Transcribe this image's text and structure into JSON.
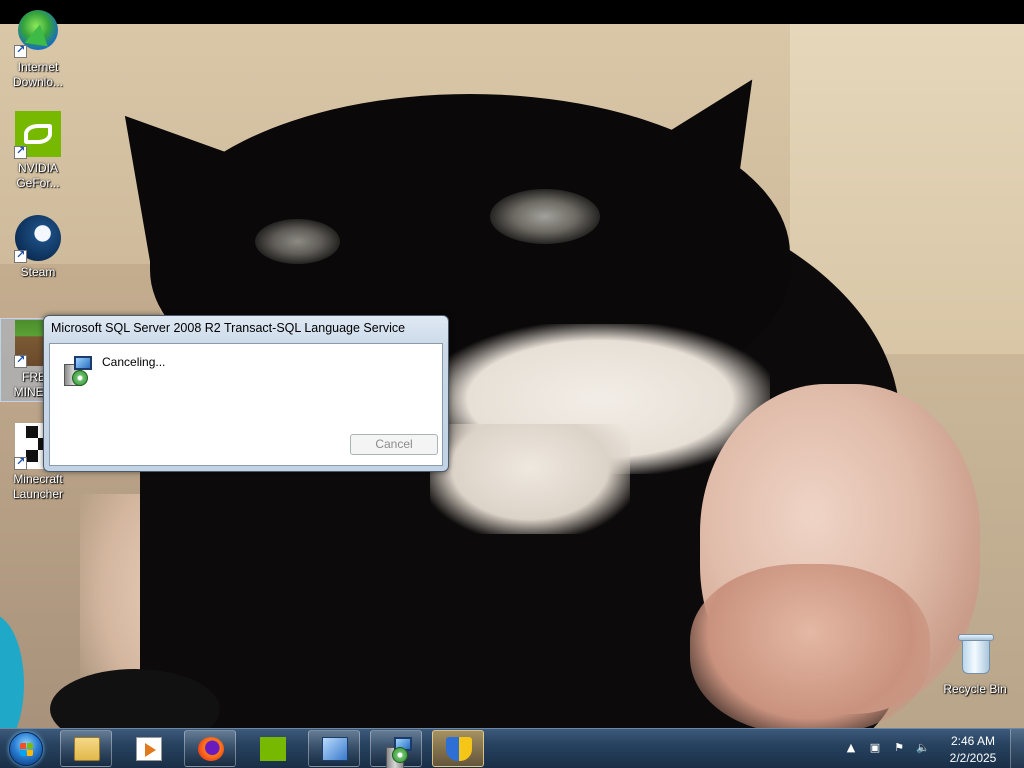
{
  "desktop": {
    "icons": [
      {
        "label": "Internet Downlo...",
        "icon": "internet-download-manager-icon"
      },
      {
        "label": "NVIDIA GeFor...",
        "icon": "nvidia-geforce-icon"
      },
      {
        "label": "Steam",
        "icon": "steam-icon"
      },
      {
        "label": "FREE MINEC...",
        "icon": "minecraft-icon"
      },
      {
        "label": "Minecraft Launcher",
        "icon": "minecraft-launcher-icon"
      },
      {
        "label": "Recycle Bin",
        "icon": "recycle-bin-icon"
      }
    ]
  },
  "dialog": {
    "title": "Microsoft SQL Server 2008 R2 Transact-SQL Language Service",
    "status": "Canceling...",
    "cancel_label": "Cancel",
    "cancel_enabled": false
  },
  "taskbar": {
    "start_icon": "windows-start-orb-icon",
    "pinned": [
      {
        "name": "windows-explorer",
        "icon": "folder-icon"
      },
      {
        "name": "windows-media-player",
        "icon": "media-player-icon"
      },
      {
        "name": "firefox",
        "icon": "firefox-icon"
      },
      {
        "name": "nvidia",
        "icon": "nvidia-icon"
      },
      {
        "name": "display-settings",
        "icon": "display-icon"
      },
      {
        "name": "setup",
        "icon": "setup-installer-icon"
      },
      {
        "name": "user-account-control",
        "icon": "uac-shield-icon"
      }
    ],
    "tray": {
      "icons": [
        "show-hidden-icons-chevron",
        "network-icon",
        "action-center-flag-icon",
        "volume-muted-icon"
      ],
      "time": "2:46 AM",
      "date": "2/2/2025"
    }
  },
  "colors": {
    "taskbar": "#27425f",
    "dialog_frame": "#c2d3e5",
    "nvidia_green": "#76b900"
  }
}
